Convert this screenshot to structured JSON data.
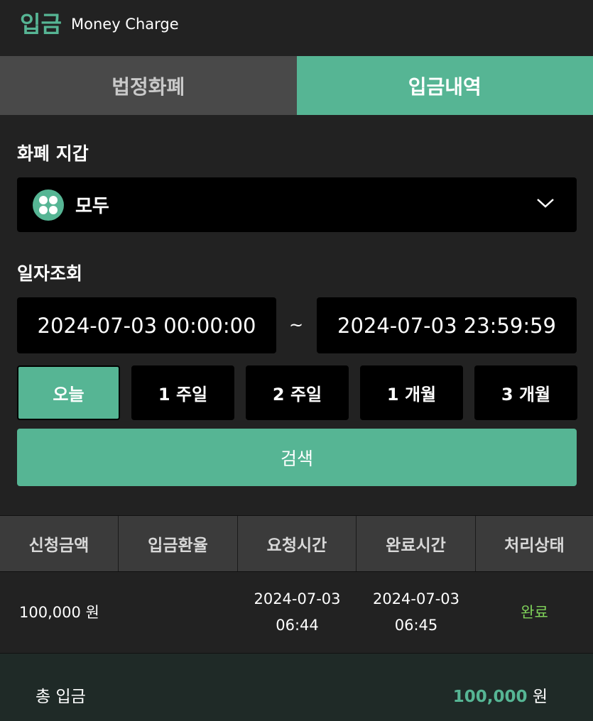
{
  "header": {
    "title_ko": "입금",
    "title_en": "Money Charge"
  },
  "tabs": [
    {
      "label": "법정화폐",
      "active": false
    },
    {
      "label": "입금내역",
      "active": true
    }
  ],
  "wallet": {
    "label": "화폐 지갑",
    "selected": "모두",
    "icon": "grid-icon"
  },
  "date": {
    "label": "일자조회",
    "from": "2024-07-03 00:00:00",
    "separator": "~",
    "to": "2024-07-03 23:59:59"
  },
  "periods": [
    "오늘",
    "1 주일",
    "2 주일",
    "1 개월",
    "3 개월"
  ],
  "search_label": "검색",
  "table": {
    "headers": [
      "신청금액",
      "입금환율",
      "요청시간",
      "완료시간",
      "처리상태"
    ],
    "rows": [
      {
        "amount": "100,000 원",
        "rate": "",
        "request_date": "2024-07-03",
        "request_time": "06:44",
        "complete_date": "2024-07-03",
        "complete_time": "06:45",
        "status": "완료"
      }
    ]
  },
  "summary": {
    "label": "총 입금",
    "total": "100,000",
    "unit": "원"
  },
  "colors": {
    "accent": "#56b594",
    "status_done": "#7fd15a"
  }
}
